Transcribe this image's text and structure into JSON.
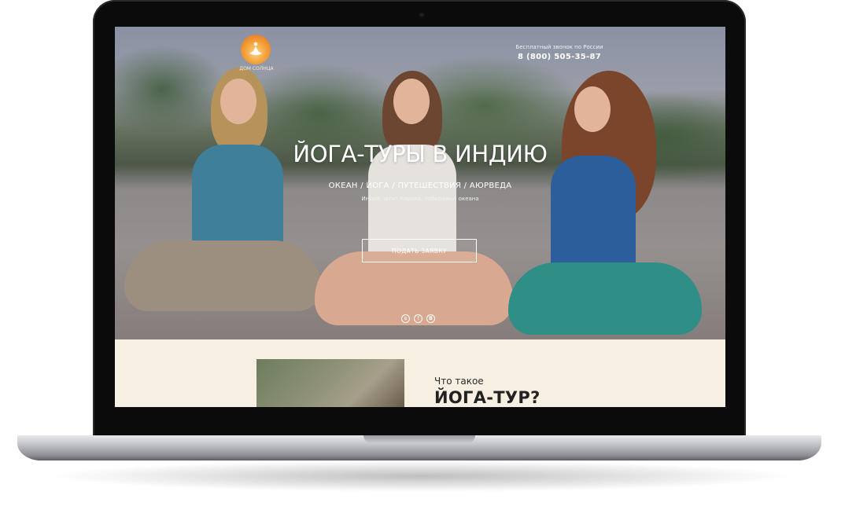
{
  "brand": {
    "logo_text": "ДОМ СОЛНЦА"
  },
  "header": {
    "phone_note": "Бесплатный звонок по России",
    "phone_number": "8 (800) 505-35-87"
  },
  "hero": {
    "title": "ЙОГА-ТУРЫ В ИНДИЮ",
    "subtitle": "ОКЕАН / ЙОГА / ПУТЕШЕСТВИЯ / АЮРВЕДА",
    "location": "Индия, штат Керала, побережье океана",
    "cta_label": "ПОДАТЬ ЗАЯВКУ"
  },
  "social": {
    "icons": [
      "vk-icon",
      "facebook-icon",
      "instagram-icon"
    ],
    "glyphs": [
      "в",
      "f",
      "◘"
    ]
  },
  "section": {
    "kicker": "Что такое",
    "title": "ЙОГА-ТУР?"
  }
}
